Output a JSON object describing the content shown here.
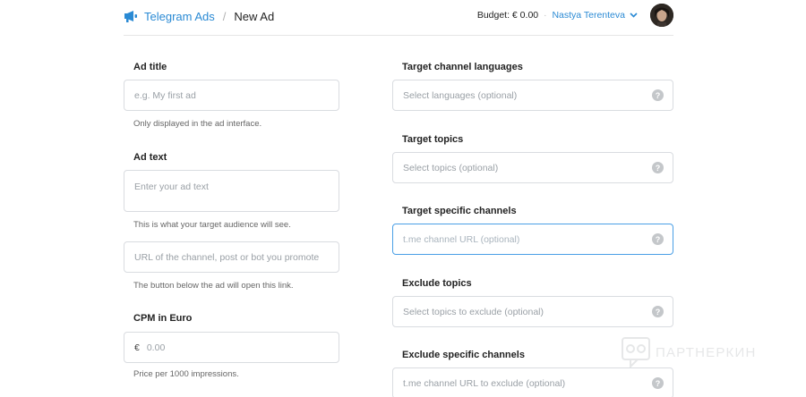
{
  "header": {
    "brand": "Telegram Ads",
    "separator": "/",
    "page_title": "New Ad",
    "budget": "Budget: € 0.00",
    "dot": "·",
    "user_name": "Nastya Terenteva"
  },
  "left": {
    "ad_title": {
      "label": "Ad title",
      "placeholder": "e.g. My first ad",
      "help": "Only displayed in the ad interface."
    },
    "ad_text": {
      "label": "Ad text",
      "placeholder": "Enter your ad text",
      "help": "This is what your target audience will see."
    },
    "url": {
      "placeholder": "URL of the channel, post or bot you promote",
      "help": "The button below the ad will open this link."
    },
    "cpm": {
      "label": "CPM in Euro",
      "currency": "€",
      "placeholder": "0.00",
      "help": "Price per 1000 impressions."
    }
  },
  "right": {
    "languages": {
      "label": "Target channel languages",
      "placeholder": "Select languages (optional)"
    },
    "topics": {
      "label": "Target topics",
      "placeholder": "Select topics (optional)"
    },
    "channels": {
      "label": "Target specific channels",
      "placeholder": "t.me channel URL (optional)"
    },
    "exclude_topics": {
      "label": "Exclude topics",
      "placeholder": "Select topics to exclude (optional)"
    },
    "exclude_channels": {
      "label": "Exclude specific channels",
      "placeholder": "t.me channel URL to exclude (optional)"
    }
  },
  "help_glyph": "?",
  "watermark": "ПАРТНЕРКИН",
  "colors": {
    "accent": "#2a8ad4",
    "focus": "#4a9fe6",
    "border": "#d9dce0"
  }
}
